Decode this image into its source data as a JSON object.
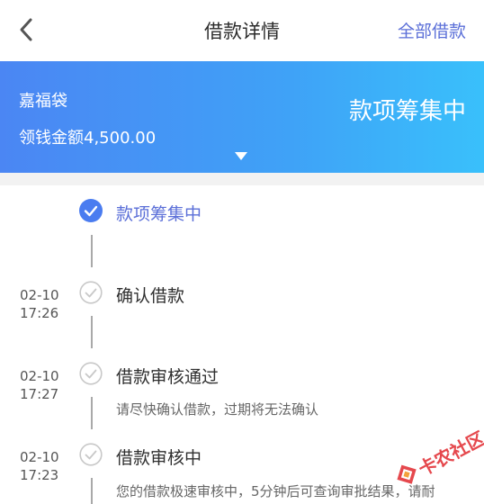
{
  "header": {
    "title": "借款详情",
    "all_loans_label": "全部借款"
  },
  "banner": {
    "product_name": "嘉福袋",
    "amount_label": "领钱金额",
    "amount_value": "4,500.00",
    "status": "款项筹集中"
  },
  "timeline": {
    "current": {
      "title": "款项筹集中"
    },
    "items": [
      {
        "date": "02-10",
        "time": "17:26",
        "title": "确认借款",
        "desc": ""
      },
      {
        "date": "02-10",
        "time": "17:27",
        "title": "借款审核通过",
        "desc": "请尽快确认借款，过期将无法确认"
      },
      {
        "date": "02-10",
        "time": "17:23",
        "title": "借款审核中",
        "desc": "您的借款极速审核中，5分钟后可查询审批结果，请耐"
      }
    ]
  },
  "watermark": {
    "text": "卡农社区"
  },
  "colors": {
    "accent": "#5b6fd8",
    "banner_start": "#4b86f3",
    "banner_end": "#39c0fb",
    "check_active": "#4a7cf0",
    "check_done": "#c8c8c8"
  }
}
